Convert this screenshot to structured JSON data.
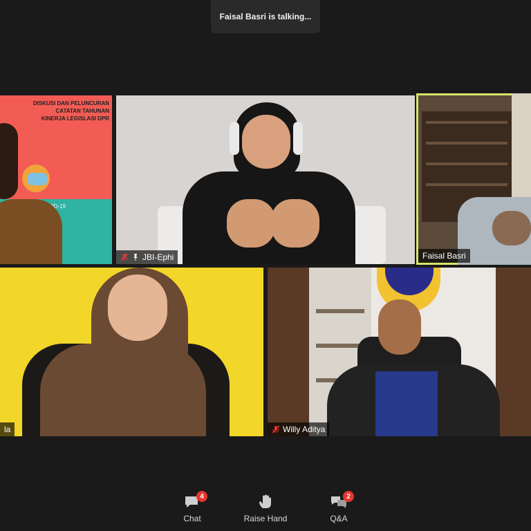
{
  "toast": {
    "text": "Faisal Basri  is talking..."
  },
  "tiles": [
    {
      "id": "banner",
      "label": "",
      "poster_lines": [
        "DISKUSI DAN PELUNCURAN",
        "CATATAN TAHUNAN",
        "KINERJA LEGISLASI DPR"
      ],
      "poster_bottom": "NDEMI COVID-19"
    },
    {
      "id": "jbi",
      "label": "JBI-Ephi",
      "muted": true,
      "pinned": true
    },
    {
      "id": "faisal",
      "label": "Faisal Basri",
      "muted": false,
      "active": true
    },
    {
      "id": "woman",
      "label": "la",
      "muted": false
    },
    {
      "id": "willy",
      "label": "Willy Aditya",
      "muted": true
    }
  ],
  "controls": [
    {
      "label": "Chat",
      "icon": "chat-icon",
      "badge": "4"
    },
    {
      "label": "Raise Hand",
      "icon": "raise-hand-icon",
      "badge": ""
    },
    {
      "label": "Q&A",
      "icon": "qa-icon",
      "badge": "2"
    }
  ],
  "colors": {
    "active_border": "#d6e66a",
    "badge": "#e8352f",
    "background": "#1a1a1a"
  }
}
